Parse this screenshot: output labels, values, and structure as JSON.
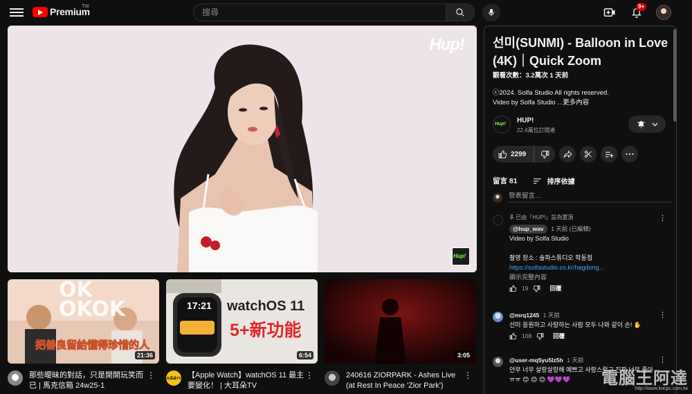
{
  "header": {
    "brand": "Premium",
    "brand_region": "TW",
    "search_placeholder": "搜尋",
    "notification_count": "9+"
  },
  "player": {
    "watermark": "Hup!"
  },
  "suggested": [
    {
      "title": "那些曖昧的對話，只是開開玩笑而已 | 馬克信箱 24w25-1",
      "duration": "21:36",
      "thumb_text_top": "OK OKOK",
      "thumb_caption": "把善良留給懂得珍惜的人"
    },
    {
      "title": "【Apple Watch】watchOS 11 最主要變化！ | 大耳朵TV",
      "duration": "6:54",
      "thumb_text_top": "watchOS 11",
      "thumb_caption": "5+新功能",
      "watch_time": "17:21",
      "channel_badge": "大耳朵TV"
    },
    {
      "title": "240616 ZIORPARK - Ashes Live (at Rest In Peace 'Zior Park')",
      "duration": "3:05"
    }
  ],
  "video": {
    "title": "선미(SUNMI) - Balloon in Love (4K)｜Quick Zoom",
    "stats": "觀看次數：3.2萬次  1 天前",
    "desc_line1": "ⓒ2024. Solfa Studio All rights reserved.",
    "desc_line2": "Video by Solfa Studio ...",
    "desc_more": "更多內容",
    "channel_name": "HUP!",
    "subscribers": "22.4萬位訂閱者",
    "like_count": "2299"
  },
  "comments_section": {
    "count_label": "留言 81",
    "sort_label": "排序依據",
    "add_placeholder": "發表留言…",
    "items": [
      {
        "pinned_note": "已由「HUP!」設為置頂",
        "author": "@hup_wav",
        "time": "1 天前 (已編輯)",
        "lines": [
          "Video by Solfa Studio",
          "",
          "촬영 장소 : 솔파스튜디오 학동점"
        ],
        "link": "https://solfastudio.co.kr/hagdong...",
        "show_more": "顯示完整內容",
        "likes": "19",
        "reply": "回覆"
      },
      {
        "author": "@mrq1245",
        "time": "1 天前",
        "lines": [
          "선미 응원하고 사랑하는 사람 모두 나와 같이 손! ✋"
        ],
        "likes": "108",
        "reply": "回覆"
      },
      {
        "author": "@user-mq5yu5lz5h",
        "time": "1 天前",
        "lines": [
          "안무 너무 살랑살랑해 예쁘고 사랑스럽고 진짜 너무 좋아",
          "ㅠㅠ 😊 😊 😊 💜💜💜"
        ]
      }
    ]
  },
  "site_watermark": {
    "name": "電腦王阿達",
    "url": "http://www.kocpc.com.tw"
  },
  "colors": {
    "background": "#0f0f0f",
    "brand_red": "#ff0000",
    "link": "#3ea6ff",
    "chip": "#272727"
  }
}
